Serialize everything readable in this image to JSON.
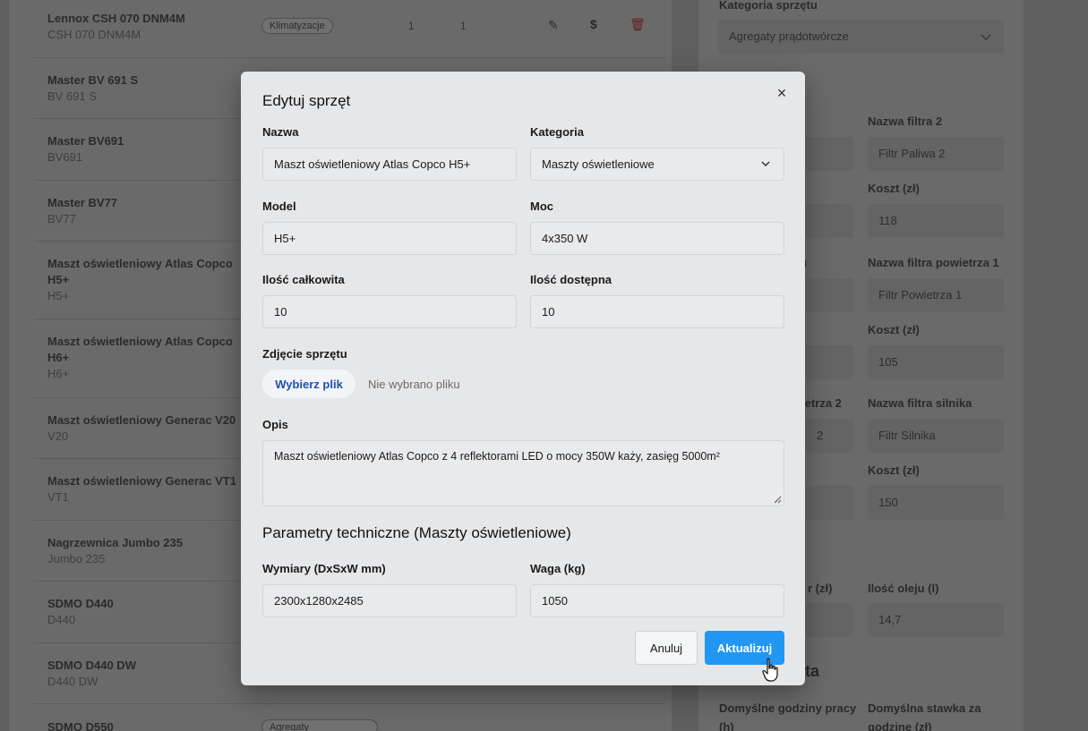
{
  "list": [
    {
      "name": "Lennox CSH 070 DNM4M",
      "model": "CSH 070 DNM4M",
      "badge": "Klimatyzacje",
      "qty_total": "1",
      "qty_available": "1"
    },
    {
      "name": "Master BV 691 S",
      "model": "BV 691 S"
    },
    {
      "name": "Master BV691",
      "model": "BV691"
    },
    {
      "name": "Master BV77",
      "model": "BV77"
    },
    {
      "name": "Maszt oświetleniowy Atlas Copco H5+",
      "model": "H5+"
    },
    {
      "name": "Maszt oświetleniowy Atlas Copco H6+",
      "model": "H6+"
    },
    {
      "name": "Maszt oświetleniowy Generac V20",
      "model": "V20"
    },
    {
      "name": "Maszt oświetleniowy Generac VT1",
      "model": "VT1"
    },
    {
      "name": "Nagrzewnica Jumbo 235",
      "model": "Jumbo 235"
    },
    {
      "name": "SDMO D440",
      "model": "D440"
    },
    {
      "name": "SDMO D440 DW",
      "model": "D440 DW"
    },
    {
      "name": "SDMO D550",
      "model": "",
      "badge": "Agregaty"
    }
  ],
  "right_panel": {
    "category_label": "Kategoria sprzętu",
    "category_value": "Agregaty prądotwórcze",
    "filter2_label": "Nazwa filtra 2",
    "filter2_value": "Filtr Paliwa 2",
    "cost1_label": "Koszt (zł)",
    "cost1_value": "118",
    "air_filter1_label_partial": "u",
    "air_filter1_label": "Nazwa filtra powietrza 1",
    "air_filter1_value": "Filtr Powietrza 1",
    "cost2_label": "Koszt (zł)",
    "cost2_value": "105",
    "air_filter2_label_partial": "wietrza 2",
    "air_filter2_value_partial": "2",
    "engine_filter_label": "Nazwa filtra silnika",
    "engine_filter_value": "Filtr Silnika",
    "cost3_label": "Koszt (zł)",
    "cost3_value": "150",
    "oil_cost_label_partial": "r (zł)",
    "oil_qty_label": "Ilość oleju (l)",
    "oil_qty_value": "14,7",
    "heading_partial": "anta",
    "default_hours_label": "Domyślne godziny pracy (h)",
    "default_rate_label": "Domyślna stawka za godzinę (zł)"
  },
  "modal": {
    "title": "Edytuj sprzęt",
    "name_label": "Nazwa",
    "name_value": "Maszt oświetleniowy Atlas Copco H5+",
    "category_label": "Kategoria",
    "category_value": "Maszty oświetleniowe",
    "model_label": "Model",
    "model_value": "H5+",
    "power_label": "Moc",
    "power_value": "4x350 W",
    "total_qty_label": "Ilość całkowita",
    "total_qty_value": "10",
    "avail_qty_label": "Ilość dostępna",
    "avail_qty_value": "10",
    "photo_label": "Zdjęcie sprzętu",
    "choose_file": "Wybierz plik",
    "no_file": "Nie wybrano pliku",
    "desc_label": "Opis",
    "desc_value": "Maszt oświetleniowy Atlas Copco z 4 reflektorami LED o mocy 350W każy, zasięg 5000m²",
    "section_title": "Parametry techniczne (Maszty oświetleniowe)",
    "dims_label": "Wymiary (DxSxW mm)",
    "dims_value": "2300x1280x2485",
    "weight_label": "Waga (kg)",
    "weight_value": "1050",
    "cancel": "Anuluj",
    "update": "Aktualizuj",
    "close_symbol": "×"
  },
  "icons": {
    "edit": "edit-icon",
    "price": "dollar-icon",
    "delete": "trash-icon",
    "chevron": "chevron-down-icon",
    "close": "close-icon",
    "cursor": "hand-pointer-icon"
  },
  "colors": {
    "primary": "#2196f3",
    "link": "#1f4fb3",
    "danger": "#dc2626"
  }
}
